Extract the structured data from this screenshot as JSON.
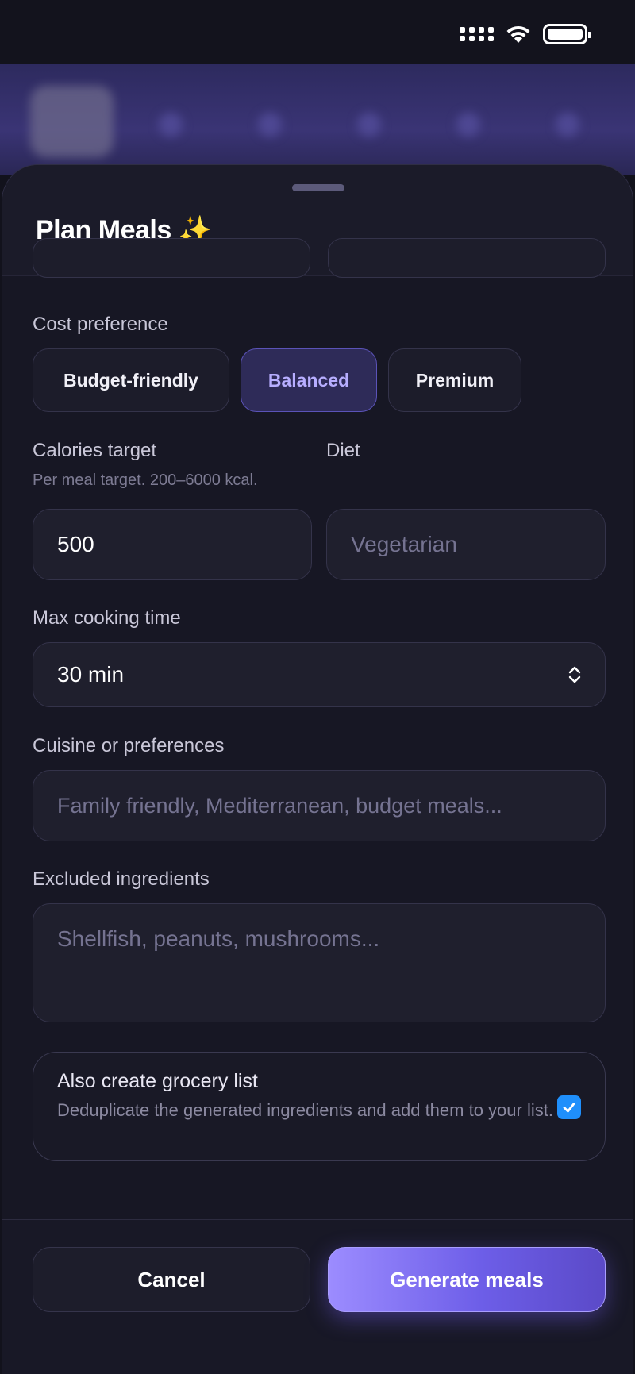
{
  "status_bar": {
    "signal_icon": "cellular-signal-icon",
    "wifi_icon": "wifi-icon",
    "battery_icon": "battery-icon"
  },
  "sheet": {
    "title": "Plan Meals ✨"
  },
  "cost_preference": {
    "label": "Cost preference",
    "options": [
      "Budget-friendly",
      "Balanced",
      "Premium"
    ],
    "selected": "Balanced"
  },
  "calories": {
    "label": "Calories target",
    "hint": "Per meal target. 200–6000 kcal.",
    "value": "500"
  },
  "diet": {
    "label": "Diet",
    "placeholder": "Vegetarian"
  },
  "cooking_time": {
    "label": "Max cooking time",
    "value": "30 min"
  },
  "cuisine": {
    "label": "Cuisine or preferences",
    "placeholder": "Family friendly, Mediterranean, budget meals..."
  },
  "excluded": {
    "label": "Excluded ingredients",
    "placeholder": "Shellfish, peanuts, mushrooms..."
  },
  "grocery": {
    "title": "Also create grocery list",
    "description": "Deduplicate the generated ingredients and add them to your list.",
    "checked": true
  },
  "footer": {
    "cancel_label": "Cancel",
    "generate_label": "Generate meals"
  },
  "colors": {
    "accent": "#7b6cf0",
    "selected_chip_text": "#b7aeff",
    "checkbox": "#1f8ffb",
    "background": "#171724"
  }
}
